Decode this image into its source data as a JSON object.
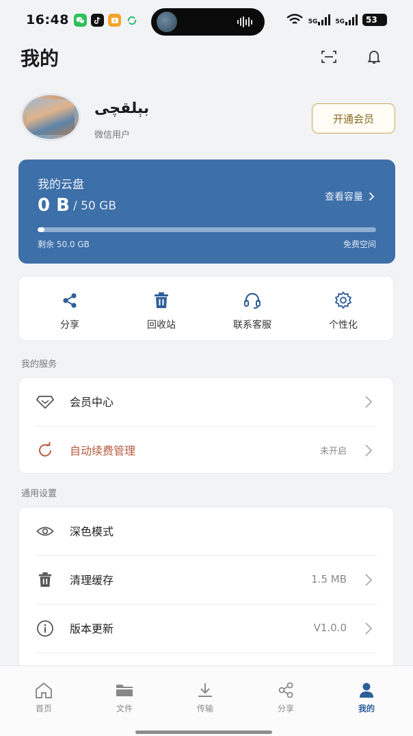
{
  "status_bar": {
    "time": "16:48",
    "signal1_label": "5G",
    "signal2_label": "5G",
    "battery": "53"
  },
  "header": {
    "title": "我的",
    "scan_icon": "scan-icon",
    "bell_icon": "bell-icon"
  },
  "profile": {
    "name": "بېلقچى",
    "subtitle": "微信用户",
    "vip_button": "开通会员"
  },
  "cloud": {
    "title": "我的云盘",
    "used": "0 B",
    "total": "/ 50 GB",
    "link": "查看容量",
    "used_fraction": 0.02,
    "remaining": "剩余 50.0 GB",
    "free_label": "免费空间",
    "card_color": "#3d6fa8"
  },
  "quick_actions": [
    {
      "label": "分享",
      "icon": "share-icon"
    },
    {
      "label": "回收站",
      "icon": "trash-icon"
    },
    {
      "label": "联系客服",
      "icon": "headset-icon"
    },
    {
      "label": "个性化",
      "icon": "gear-icon"
    }
  ],
  "services": {
    "title": "我的服务",
    "items": [
      {
        "label": "会员中心",
        "value": "",
        "icon": "diamond-icon"
      },
      {
        "label": "自动续费管理",
        "value": "未开启",
        "icon": "refresh-icon",
        "accent": "#b45a3c"
      }
    ]
  },
  "settings": {
    "title": "通用设置",
    "items": [
      {
        "label": "深色模式",
        "value": "",
        "icon": "eye-icon"
      },
      {
        "label": "清理缓存",
        "value": "1.5 MB",
        "icon": "trash-icon"
      },
      {
        "label": "版本更新",
        "value": "V1.0.0",
        "icon": "info-icon"
      }
    ]
  },
  "tabs": [
    {
      "label": "首页",
      "icon": "home-icon"
    },
    {
      "label": "文件",
      "icon": "folder-icon"
    },
    {
      "label": "传输",
      "icon": "download-icon"
    },
    {
      "label": "分享",
      "icon": "share-icon"
    },
    {
      "label": "我的",
      "icon": "user-icon",
      "active": true
    }
  ],
  "colors": {
    "brand_blue": "#2f5f99",
    "vip_gold": "#c9a75a"
  }
}
